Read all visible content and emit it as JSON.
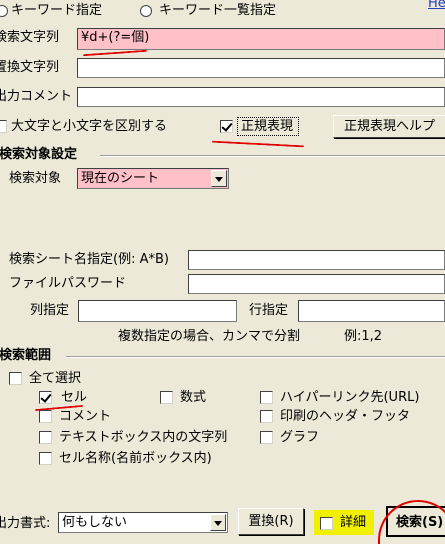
{
  "top_radio": {
    "option1": "キーワード指定",
    "option2": "キーワード一覧指定",
    "corner_link": "He"
  },
  "search_text": {
    "label": "検索文字列",
    "value": "¥d+(?=個)"
  },
  "replace_text": {
    "label": "置換文字列",
    "value": ""
  },
  "output_comment": {
    "label": "出力コメント",
    "value": ""
  },
  "case_option": {
    "label": "大文字と小文字を区別する",
    "checked": false
  },
  "regex_option": {
    "label": "正規表現",
    "checked": true
  },
  "regex_help_button": "正規表現ヘルプ",
  "target_settings": {
    "section_title": "検索対象設定",
    "target_label": "検索対象",
    "target_value": "現在のシート",
    "sheet_name_label": "検索シート名指定(例: A*B)",
    "sheet_name_value": "",
    "file_password_label": "ファイルパスワード",
    "file_password_value": "",
    "column_label": "列指定",
    "column_value": "",
    "row_label": "行指定",
    "row_value": "",
    "hint": "複数指定の場合、カンマで分割",
    "example": "例:1,2"
  },
  "search_range": {
    "section_title": "検索範囲",
    "select_all": {
      "label": "全て選択",
      "checked": false
    },
    "options": [
      {
        "label": "セル",
        "checked": true
      },
      {
        "label": "数式",
        "checked": false
      },
      {
        "label": "ハイパーリンク先(URL)",
        "checked": false
      },
      {
        "label": "コメント",
        "checked": false
      },
      {
        "label": "印刷のヘッダ・フッタ",
        "checked": false
      },
      {
        "label": "テキストボックス内の文字列",
        "checked": false
      },
      {
        "label": "グラフ",
        "checked": false
      },
      {
        "label": "セル名称(名前ボックス内)",
        "checked": false
      }
    ]
  },
  "footer": {
    "output_format_label": "出力書式:",
    "output_format_value": "何もしない",
    "replace_button": "置換(R)",
    "detail_checkbox": {
      "label": "詳細",
      "checked": false
    },
    "search_button": "検索(S)"
  },
  "colors": {
    "pink_field": "#ffc0c8",
    "highlight": "#f0f000",
    "annotation_red": "#e00000"
  }
}
